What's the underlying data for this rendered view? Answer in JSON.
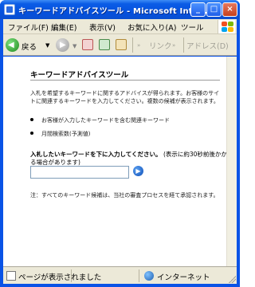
{
  "window": {
    "title": "キーワードアドバイスツール - Microsoft Inter..."
  },
  "menubar": {
    "items": [
      "ファイル(F)",
      "編集(E)",
      "表示(V)",
      "お気に入り(A)",
      "ツール"
    ]
  },
  "toolbar": {
    "back_label": "戻る",
    "links_label": "リンク",
    "address_label": "アドレス(D)"
  },
  "page": {
    "heading": "キーワードアドバイスツール",
    "intro": "入札を希望するキーワードに関するアドバイスが得られます。お客様のサイトに関連するキーワードを入力してください。複数の候補が表示されます。",
    "bullets": [
      "お客様が入力したキーワードを含む関連キーワード",
      "月間検索数(予測値)"
    ],
    "prompt_bold": "入札したいキーワードを下に入力してください。",
    "prompt_rest": "(表示に約30秒前後かかる場合があります)",
    "keyword_value": "",
    "note": "注：すべてのキーワード候補は、当社の審査プロセスを経て承認されます。"
  },
  "status": {
    "left_text": "ページが表示されました",
    "zone_text": "インターネット"
  },
  "colors": {
    "titlebar": "#0550dc",
    "chrome": "#ece9d8"
  }
}
